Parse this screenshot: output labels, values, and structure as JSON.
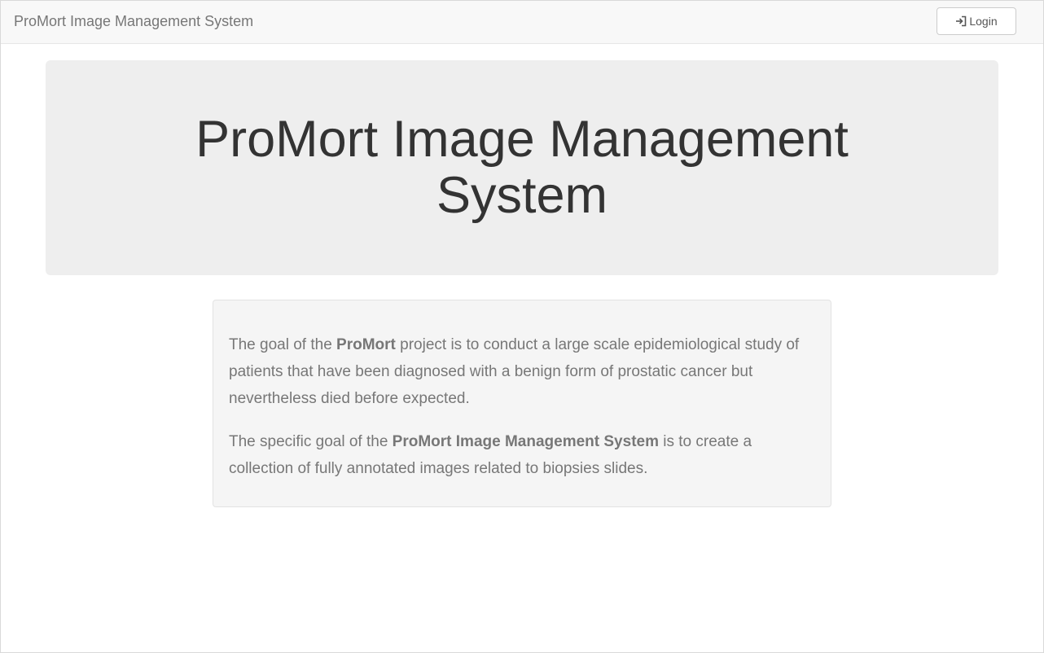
{
  "navbar": {
    "brand": "ProMort Image Management System",
    "login_label": "Login",
    "login_icon": "log-in-icon"
  },
  "jumbotron": {
    "title": "ProMort Image Management System"
  },
  "description": {
    "p1_prefix": "The goal of the ",
    "p1_strong": "ProMort",
    "p1_suffix": " project is to conduct a large scale epidemiological study of patients that have been diagnosed with a benign form of prostatic cancer but nevertheless died before expected.",
    "p2_prefix": "The specific goal of the ",
    "p2_strong": "ProMort Image Management System",
    "p2_suffix": " is to create a collection of fully annotated images related to biopsies slides."
  },
  "colors": {
    "navbar_bg": "#f8f8f8",
    "jumbotron_bg": "#eeeeee",
    "well_bg": "#f5f5f5",
    "text_muted": "#777777",
    "heading": "#333333"
  }
}
